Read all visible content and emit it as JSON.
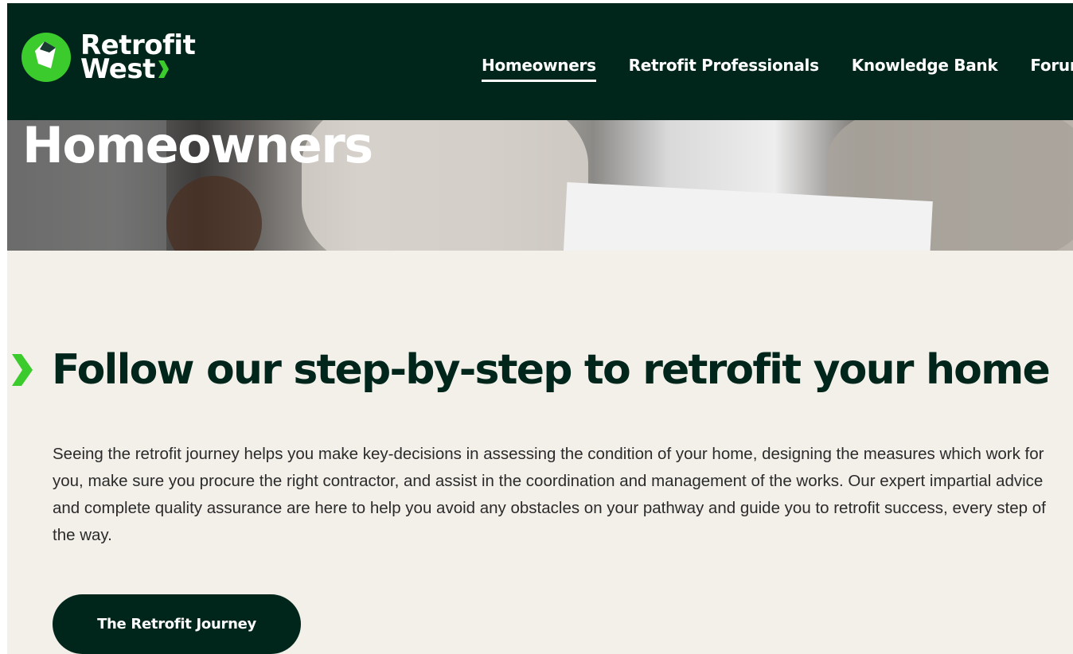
{
  "brand": {
    "name_line1": "Retrofit",
    "name_line2": "West",
    "icon": "retrofit-west-logo-icon",
    "colors": {
      "dark_green": "#00261c",
      "bright_green": "#3ccb2c",
      "background": "#f3f0ea"
    }
  },
  "nav": {
    "items": [
      {
        "label": "Homeowners",
        "active": true
      },
      {
        "label": "Retrofit Professionals",
        "active": false
      },
      {
        "label": "Knowledge Bank",
        "active": false
      },
      {
        "label": "Forur",
        "active": false
      }
    ]
  },
  "hero": {
    "title": "Homeowners"
  },
  "main": {
    "heading_icon": "chevron-right-icon",
    "heading": "Follow our step-by-step to retrofit your home",
    "intro": "Seeing the retrofit journey helps you make key-decisions in assessing the condition of your home, designing the measures which work for you, make sure you procure the right contractor, and assist in the coordination and management of the works. Our expert impartial advice and complete quality assurance are here to help you avoid any obstacles on your pathway and guide you to retrofit success, every step of the way.",
    "cta_label": "The Retrofit Journey"
  }
}
